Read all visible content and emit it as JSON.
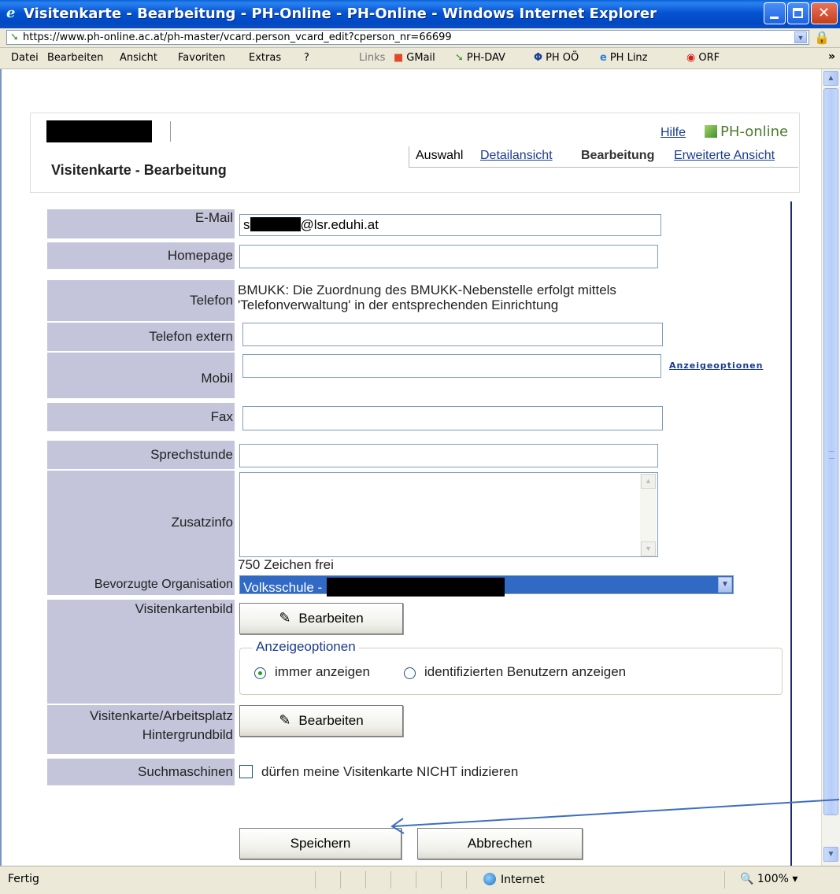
{
  "window": {
    "title": "Visitenkarte - Bearbeitung - PH-Online - PH-Online - Windows Internet Explorer",
    "url": "https://www.ph-online.ac.at/ph-master/vcard.person_vcard_edit?cperson_nr=66699"
  },
  "menu": {
    "items": [
      "Datei",
      "Bearbeiten",
      "Ansicht",
      "Favoriten",
      "Extras",
      "?"
    ],
    "links_label": "Links",
    "links": [
      "GMail",
      "PH-DAV",
      "PH OÖ",
      "PH Linz",
      "ORF"
    ]
  },
  "header": {
    "help": "Hilfe",
    "brand": "PH-online",
    "tabs": {
      "auswahl": "Auswahl",
      "detailansicht": "Detailansicht",
      "bearbeitung": "Bearbeitung",
      "erweitert": "Erweiterte Ansicht"
    },
    "page_title": "Visitenkarte - Bearbeitung"
  },
  "form": {
    "email_label": "E-Mail",
    "email_prefix": "s",
    "email_suffix": "@lsr.eduhi.at",
    "homepage_label": "Homepage",
    "homepage_value": "",
    "telefon_label": "Telefon",
    "telefon_note_1": "BMUKK: Die Zuordnung des BMUKK-Nebenstelle erfolgt mittels",
    "telefon_note_2": "'Telefonverwaltung' in der entsprechenden Einrichtung",
    "telefon_extern_label": "Telefon extern",
    "mobil_label": "Mobil",
    "mobil_options_link": "Anzeigeoptionen",
    "fax_label": "Fax",
    "sprechstunde_label": "Sprechstunde",
    "zusatzinfo_label": "Zusatzinfo",
    "chars_free": "750 Zeichen frei",
    "org_label": "Bevorzugte Organisation",
    "org_value": "Volksschule -",
    "vk_bild_label": "Visitenkartenbild",
    "edit_label": "Bearbeiten",
    "display_options_legend": "Anzeigeoptionen",
    "radio_always": "immer anzeigen",
    "radio_identified": "identifizierten Benutzern anzeigen",
    "bg_label_1": "Visitenkarte/Arbeitsplatz",
    "bg_label_2": "Hintergrundbild",
    "search_label": "Suchmaschinen",
    "search_checkbox": "dürfen meine Visitenkarte NICHT indizieren",
    "save": "Speichern",
    "cancel": "Abbrechen"
  },
  "status": {
    "text": "Fertig",
    "zone": "Internet",
    "zoom": "100%"
  }
}
